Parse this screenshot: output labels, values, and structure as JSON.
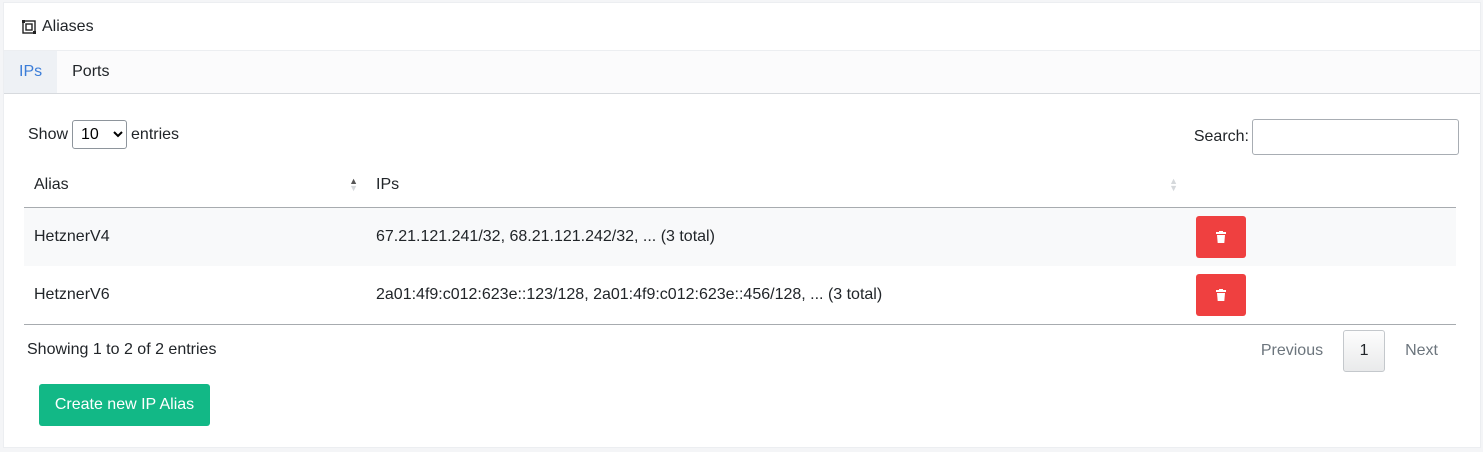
{
  "header": {
    "icon": "alias-box-icon",
    "title": "Aliases"
  },
  "tabs": [
    {
      "label": "IPs",
      "active": true
    },
    {
      "label": "Ports",
      "active": false
    }
  ],
  "length": {
    "prefix": "Show",
    "value": "10",
    "suffix": "entries"
  },
  "search": {
    "label": "Search:",
    "value": ""
  },
  "table": {
    "columns": [
      "Alias",
      "IPs",
      ""
    ],
    "rows": [
      {
        "alias": "HetznerV4",
        "ips": "67.21.121.241/32, 68.21.121.242/32, ... (3 total)"
      },
      {
        "alias": "HetznerV6",
        "ips": "2a01:4f9:c012:623e::123/128, 2a01:4f9:c012:623e::456/128, ... (3 total)"
      }
    ]
  },
  "info": "Showing 1 to 2 of 2 entries",
  "pagination": {
    "previous": "Previous",
    "current": "1",
    "next": "Next"
  },
  "create_button": "Create new IP Alias",
  "colors": {
    "accent": "#3b7dd8",
    "danger": "#ef4040",
    "success": "#12b886"
  }
}
